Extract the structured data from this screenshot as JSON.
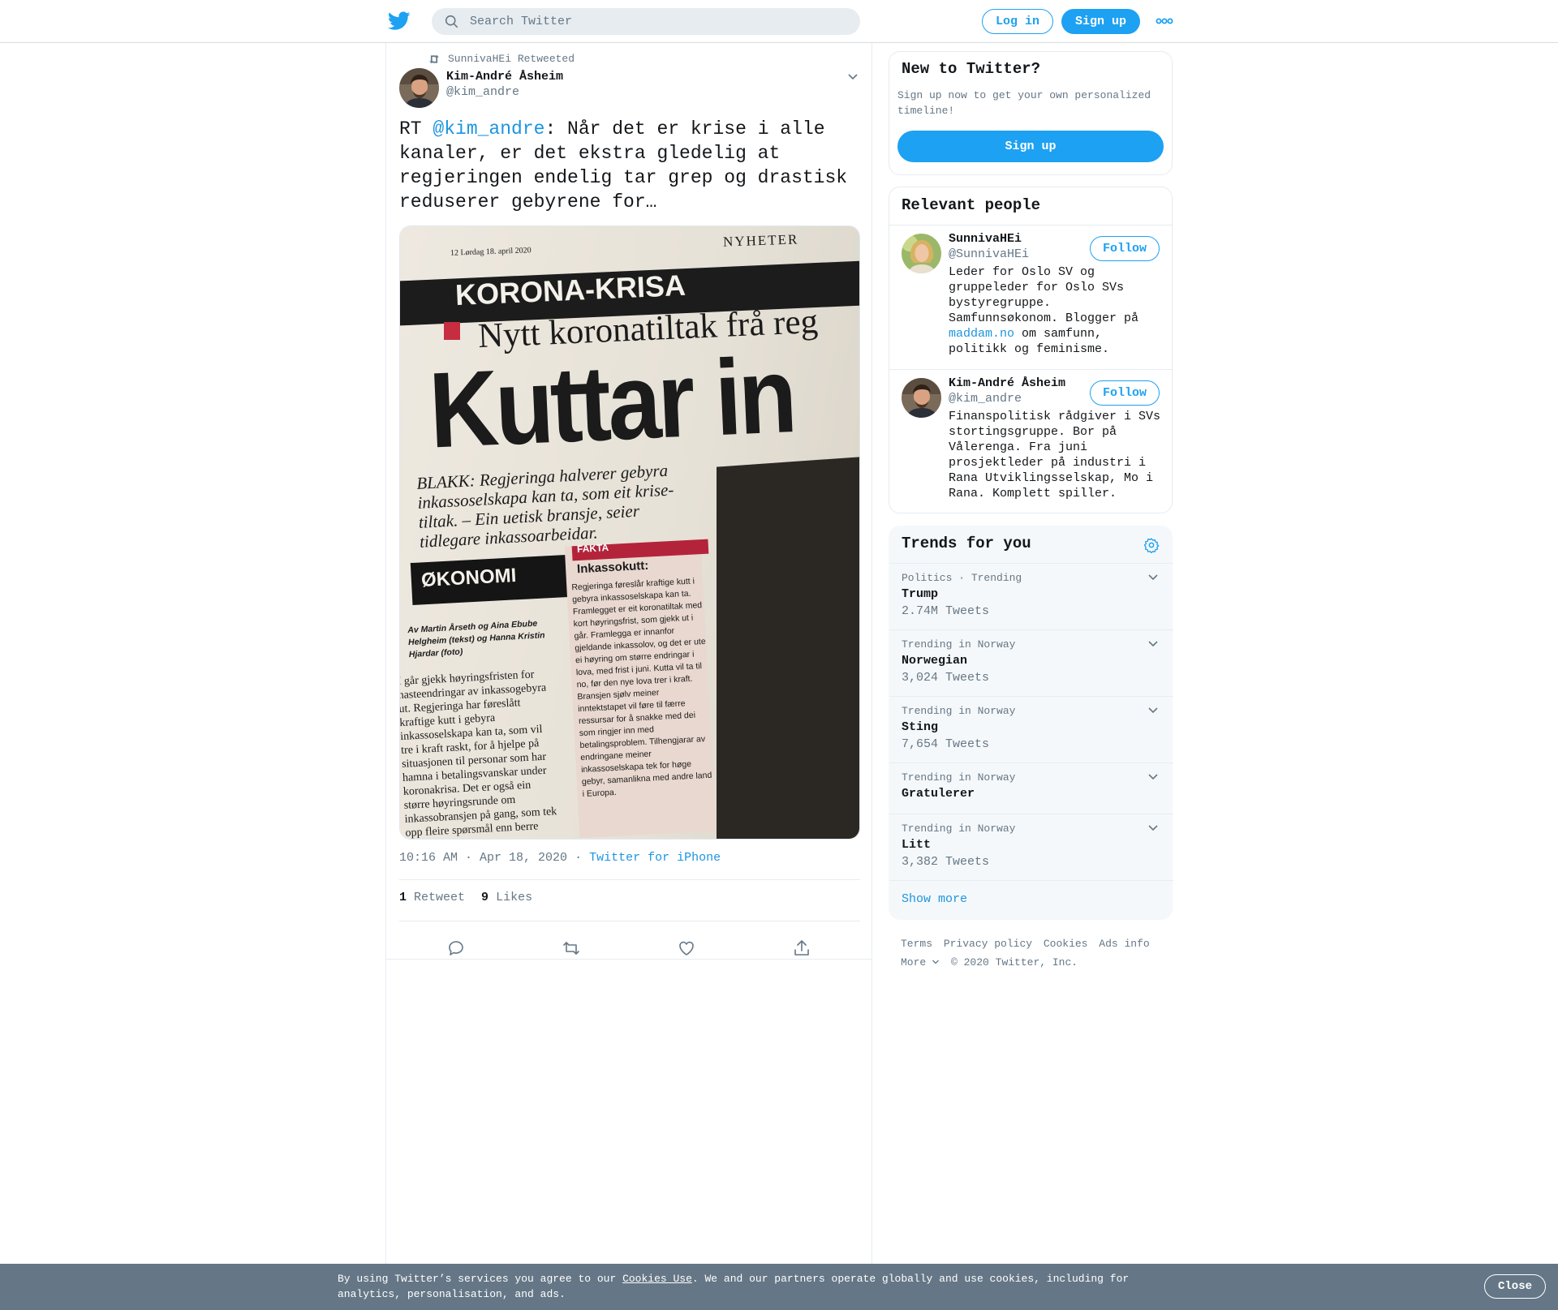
{
  "header": {
    "search_placeholder": "Search Twitter",
    "login_label": "Log in",
    "signup_label": "Sign up"
  },
  "tweet": {
    "retweeted_by": "SunnivaHEi Retweeted",
    "author_name": "Kim-André Åsheim",
    "author_handle": "@kim_andre",
    "text_prefix": "RT ",
    "mention": "@kim_andre",
    "text_body": ": Når det er krise i alle kanaler, er det  ekstra gledelig at regjeringen endelig tar grep og drastisk reduserer gebyrene for…",
    "timestamp": "10:16 AM · Apr 18, 2020",
    "source_sep": "·",
    "source": "Twitter for iPhone",
    "retweet_count": "1",
    "retweet_label": "Retweet",
    "like_count": "9",
    "like_label": "Likes",
    "photo": {
      "page_line": "12  Lørdag 18. april 2020",
      "section": "NYHETER",
      "kicker": "KORONA-KRISA",
      "headline_small": "Nytt koronatiltak frå reg",
      "headline_big": "Kuttar in",
      "lede": "BLAKK: Regjeringa halverer gebyra inkassoselskapa kan ta, som eit krise-tiltak. – Ein uetisk bransje, seier tidlegare inkassoarbeidar.",
      "fakta": "FAKTA",
      "fakta_title": "Inkassokutt:",
      "okonomi": "ØKONOMI",
      "byline": "Av Martin Årseth og Aina Ebube Helgheim (tekst) og Hanna Kristin Hjardar (foto)",
      "body": "I går gjekk høyringsfristen for hasteendringar av inkassogebyra ut. Regjeringa har føreslått kraftige kutt i gebyra inkassoselskapa kan ta, som vil tre i kraft raskt, for å hjelpe på situasjonen til personar som har hamna i betalingsvanskar under koronakrisa. Det er også ein større høyringsrunde om inkassobransjen på gang, som tek opp fleire spørsmål enn berre salæra,",
      "fakta_body": "Regjeringa føreslår kraftige kutt i gebyra inkassoselskapa kan ta. Framlegget er eit koronatiltak med kort høyringsfrist, som gjekk ut i går. Framlegga er innanfor gjeldande inkassolov, og det er ute ei høyring om større endringar i lova, med frist i juni. Kutta vil ta til no, før den nye lova trer i kraft. Bransjen sjølv meiner inntektstapet vil føre til færre ressursar for å snakke med dei som ringjer inn med betalingsproblem. Tilhengjarar av endringane meiner inkassoselskapa tek for høge gebyr, samanlikna med andre land i Europa."
    }
  },
  "sidebar": {
    "signup_card": {
      "title": "New to Twitter?",
      "desc": "Sign up now to get your own personalized timeline!",
      "button": "Sign up"
    },
    "people_card": {
      "title": "Relevant people",
      "people": [
        {
          "name": "SunnivaHEi",
          "handle": "@SunnivaHEi",
          "bio_before": "Leder for Oslo SV og gruppeleder for Oslo SVs bystyregruppe. Samfunnsøkonom. Blogger på ",
          "bio_link": "maddam.no",
          "bio_after": " om samfunn, politikk og feminisme.",
          "follow": "Follow"
        },
        {
          "name": "Kim-André Åsheim",
          "handle": "@kim_andre",
          "bio_before": "Finanspolitisk rådgiver i SVs stortingsgruppe. Bor på Vålerenga. Fra juni prosjektleder på industri i Rana Utviklingsselskap, Mo i Rana. Komplett spiller.",
          "follow": "Follow"
        }
      ]
    },
    "trends_card": {
      "title": "Trends for you",
      "trends": [
        {
          "context": "Politics · Trending",
          "name": "Trump",
          "count": "2.74M Tweets"
        },
        {
          "context": "Trending in Norway",
          "name": "Norwegian",
          "count": "3,024 Tweets"
        },
        {
          "context": "Trending in Norway",
          "name": "Sting",
          "count": "7,654 Tweets"
        },
        {
          "context": "Trending in Norway",
          "name": "Gratulerer",
          "count": ""
        },
        {
          "context": "Trending in Norway",
          "name": "Litt",
          "count": "3,382 Tweets"
        }
      ],
      "show_more": "Show more"
    },
    "footer": {
      "links": [
        "Terms",
        "Privacy policy",
        "Cookies",
        "Ads info"
      ],
      "more": "More",
      "copyright": "© 2020 Twitter, Inc."
    }
  },
  "cookie_bar": {
    "text_before": "By using Twitter’s services you agree to our ",
    "link": "Cookies Use",
    "text_after": ". We and our partners operate globally and use cookies, including for analytics, personalisation, and ads.",
    "close": "Close"
  },
  "colors": {
    "accent": "#1da1f2",
    "link": "#1b95e0",
    "secondary_text": "#657786",
    "cookie_bar": "#657786"
  }
}
